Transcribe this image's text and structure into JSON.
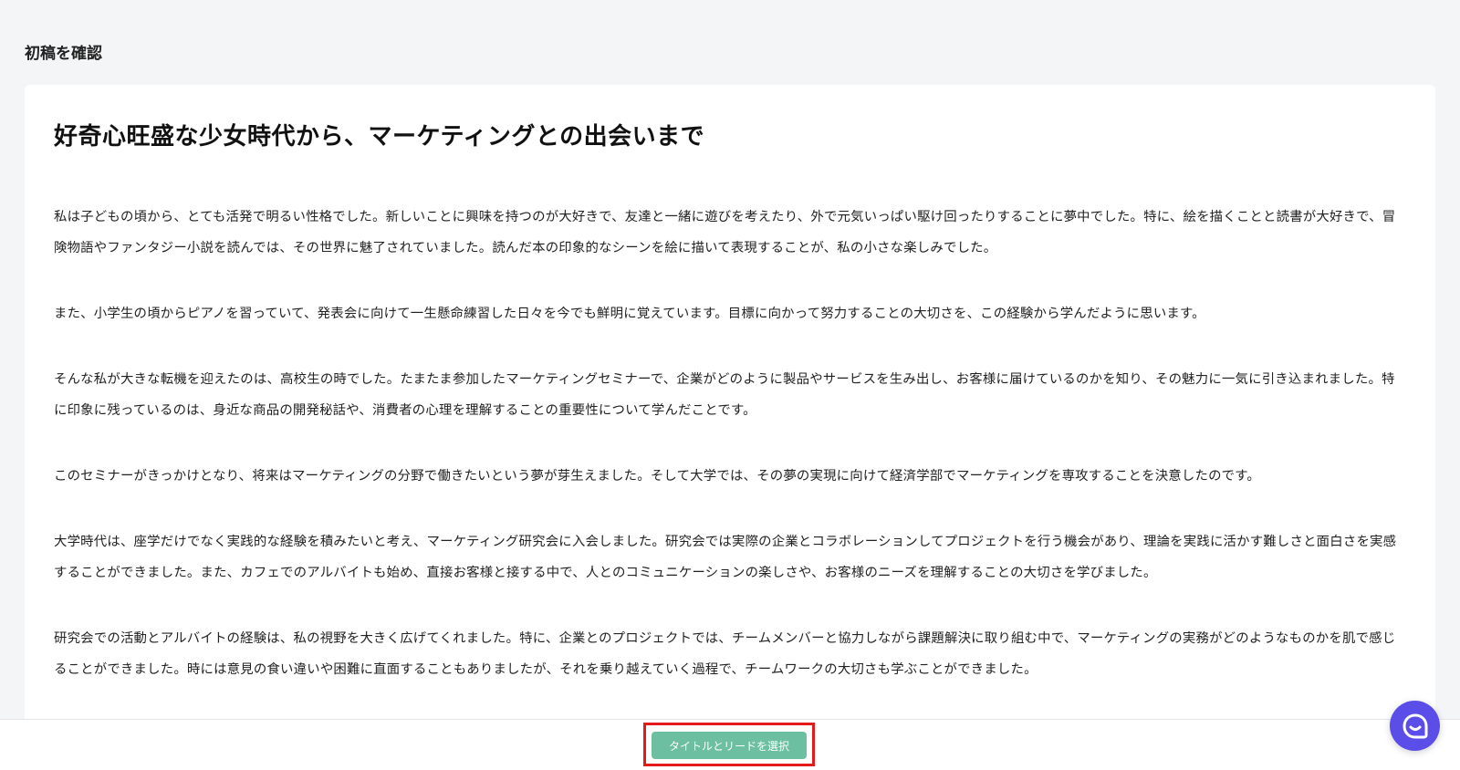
{
  "section": {
    "title": "初稿を確認"
  },
  "article": {
    "title": "好奇心旺盛な少女時代から、マーケティングとの出会いまで",
    "paragraphs": [
      "私は子どもの頃から、とても活発で明るい性格でした。新しいことに興味を持つのが大好きで、友達と一緒に遊びを考えたり、外で元気いっぱい駆け回ったりすることに夢中でした。特に、絵を描くことと読書が大好きで、冒険物語やファンタジー小説を読んでは、その世界に魅了されていました。読んだ本の印象的なシーンを絵に描いて表現することが、私の小さな楽しみでした。",
      "また、小学生の頃からピアノを習っていて、発表会に向けて一生懸命練習した日々を今でも鮮明に覚えています。目標に向かって努力することの大切さを、この経験から学んだように思います。",
      "そんな私が大きな転機を迎えたのは、高校生の時でした。たまたま参加したマーケティングセミナーで、企業がどのように製品やサービスを生み出し、お客様に届けているのかを知り、その魅力に一気に引き込まれました。特に印象に残っているのは、身近な商品の開発秘話や、消費者の心理を理解することの重要性について学んだことです。",
      "このセミナーがきっかけとなり、将来はマーケティングの分野で働きたいという夢が芽生えました。そして大学では、その夢の実現に向けて経済学部でマーケティングを専攻することを決意したのです。",
      "大学時代は、座学だけでなく実践的な経験を積みたいと考え、マーケティング研究会に入会しました。研究会では実際の企業とコラボレーションしてプロジェクトを行う機会があり、理論を実践に活かす難しさと面白さを実感することができました。また、カフェでのアルバイトも始め、直接お客様と接する中で、人とのコミュニケーションの楽しさや、お客様のニーズを理解することの大切さを学びました。",
      "研究会での活動とアルバイトの経験は、私の視野を大きく広げてくれました。特に、企業とのプロジェクトでは、チームメンバーと協力しながら課題解決に取り組む中で、マーケティングの実務がどのようなものかを肌で感じることができました。時には意見の食い違いや困難に直面することもありましたが、それを乗り越えていく過程で、チームワークの大切さも学ぶことができました。"
    ]
  },
  "footer": {
    "button_label": "タイトルとリードを選択"
  },
  "chat": {
    "icon": "chat-bubble-icon"
  },
  "colors": {
    "button_bg": "#6cbfa0",
    "highlight": "#e31b1b",
    "chat_fab": "#5b4ee8",
    "card_bg": "#ffffff",
    "page_bg": "#f4f5f7"
  }
}
